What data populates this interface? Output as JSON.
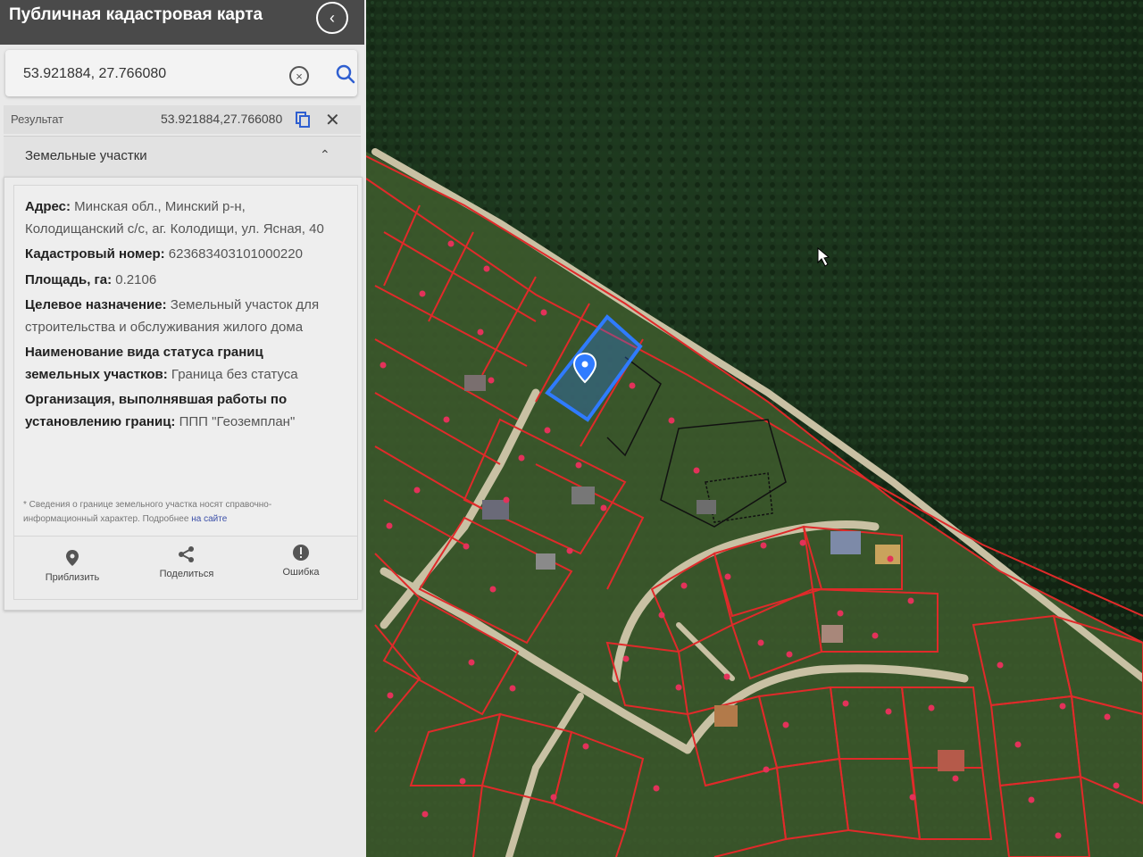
{
  "header": {
    "title": "Публичная кадастровая карта"
  },
  "search": {
    "value": "53.921884, 27.766080"
  },
  "result": {
    "label": "Результат",
    "coords": "53.921884,27.766080"
  },
  "section": {
    "title": "Земельные участки"
  },
  "parcel": {
    "address_label": "Адрес:",
    "address_value": "Минская обл., Минский р-н, Колодищанский с/с, аг. Колодищи, ул. Ясная, 40",
    "cadastral_label": "Кадастровый номер:",
    "cadastral_value": "623683403101000220",
    "area_label": "Площадь, га:",
    "area_value": "0.2106",
    "purpose_label": "Целевое назначение:",
    "purpose_value": "Земельный участок для строительства и обслуживания жилого дома",
    "status_label": "Наименование вида статуса границ земельных участков:",
    "status_value": "Граница без статуса",
    "org_label": "Организация, выполнявшая работы по установлению границ:",
    "org_value": "ППП \"Геоземплан\""
  },
  "note": {
    "text": "* Сведения о границе земельного участка носят справочно-информационный характер. Подробнее",
    "link": "на сайте"
  },
  "actions": {
    "zoom": "Приблизить",
    "share": "Поделиться",
    "error": "Ошибка"
  },
  "colors": {
    "topbar": "#4a4a4a",
    "parcel_border": "#e02a2a",
    "selected_parcel": "#2f7bff",
    "forest": "#142a16",
    "road": "#c9c1a4"
  },
  "icons": [
    "chevron-left-icon",
    "clear-icon",
    "search-icon",
    "copy-icon",
    "close-icon",
    "chevron-up-icon",
    "map-pin-icon",
    "share-icon",
    "error-icon",
    "cursor-icon"
  ]
}
